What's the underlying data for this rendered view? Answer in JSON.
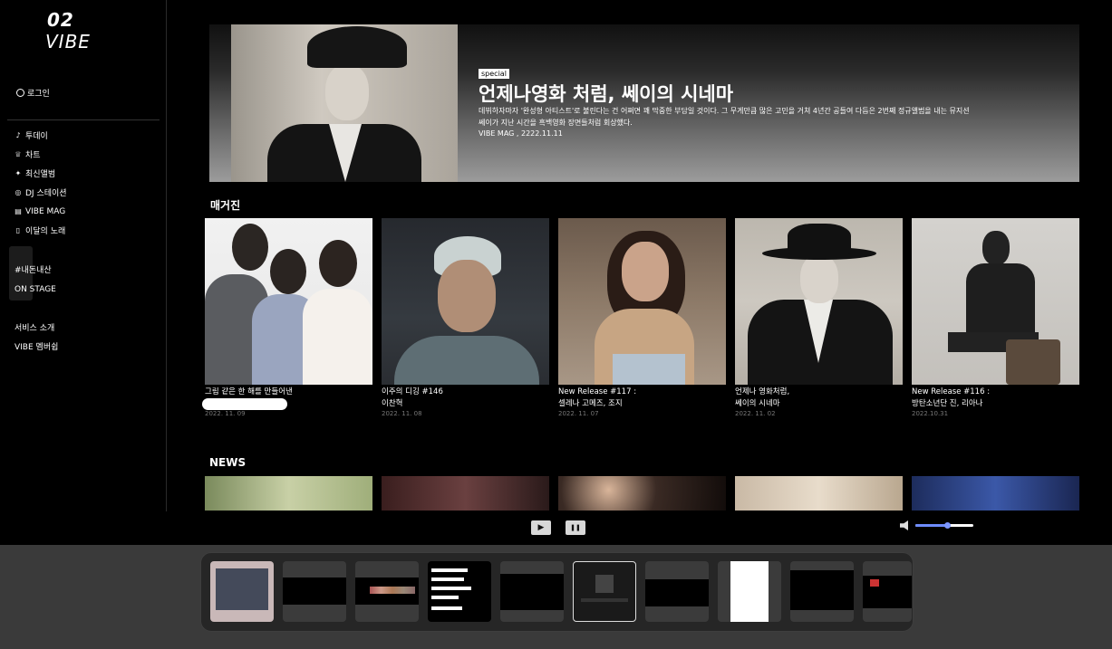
{
  "logo": {
    "line1": "02",
    "line2": "VIBE"
  },
  "sidebar": {
    "login": "로그인",
    "menu": [
      {
        "label": "투데이",
        "icon": "music-note-icon"
      },
      {
        "label": "차트",
        "icon": "trophy-icon"
      },
      {
        "label": "최신앨범",
        "icon": "sparkle-icon"
      },
      {
        "label": "DJ 스테이션",
        "icon": "radio-icon"
      },
      {
        "label": "VIBE MAG",
        "icon": "magazine-icon"
      },
      {
        "label": "이달의 노래",
        "icon": "document-music-icon"
      }
    ],
    "promo": [
      "#내돈내산",
      "ON STAGE"
    ],
    "footer": [
      "서비스 소개",
      "VIBE 멤버쉽"
    ]
  },
  "hero": {
    "badge": "special",
    "title": "언제나영화 처럼, 쎄이의 시네마",
    "desc_line1": "데뷔하자마자 '완성형 아티스트'로 불린다는 건 어쩌면 꽤 막중한 부담일 것이다. 그 무게만큼 많은 고민을 거쳐 4년간 공들여 다듬은 2번째 정규앨범을 내는 뮤지션",
    "desc_line2": "쎄이가 지난 시간을 흑백영화 장면들처럼 회상했다.",
    "meta": "VIBE MAG , 2222.11.11"
  },
  "magazine": {
    "title": "매거진",
    "cards": [
      {
        "line1": "그림 같은 한 해를 만들어낸",
        "line2": "",
        "date": "2022. 11. 09"
      },
      {
        "line1": "이주의 디깅 #146",
        "line2": "이찬혁",
        "date": "2022. 11. 08"
      },
      {
        "line1": "New Release #117 :",
        "line2": "셀레나 고메즈, 조지",
        "date": "2022. 11. 07"
      },
      {
        "line1": "언제나 영화처럼,",
        "line2": "쎄이의 시네마",
        "date": "2022. 11. 02"
      },
      {
        "line1": "New Release #116 :",
        "line2": "방탄소년단 진, 리아나",
        "date": "2022.10.31"
      }
    ]
  },
  "news": {
    "title": "NEWS"
  },
  "player": {
    "play": "▶",
    "pause": "❚❚",
    "volume": 0.55
  },
  "dock": {
    "count": 10
  }
}
